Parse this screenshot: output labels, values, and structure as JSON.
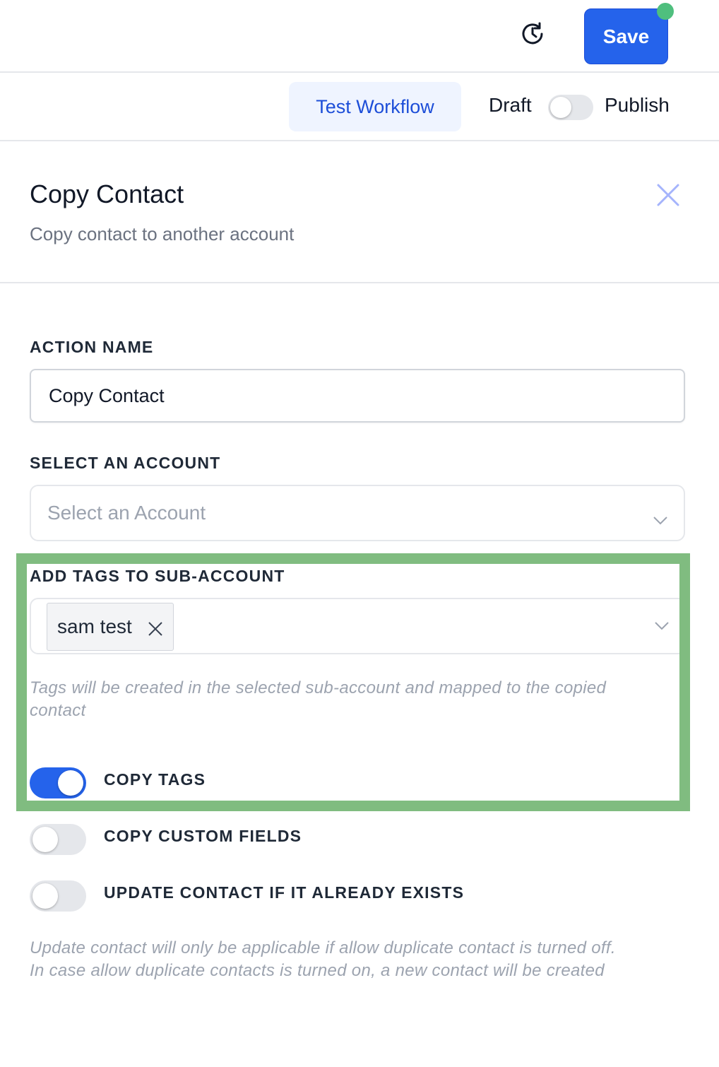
{
  "topbar": {
    "history_icon": "history-clock-icon",
    "save_label": "Save",
    "status_dot_color": "#4fbf7e"
  },
  "actionbar": {
    "test_workflow_label": "Test Workflow",
    "draft_label": "Draft",
    "publish_label": "Publish",
    "publish_toggle_on": false
  },
  "panel": {
    "title": "Copy Contact",
    "subtitle": "Copy contact to another account",
    "close_icon": "close-icon"
  },
  "form": {
    "action_name_label": "ACTION NAME",
    "action_name_value": "Copy Contact",
    "account_label": "SELECT AN ACCOUNT",
    "account_placeholder": "Select an Account",
    "tags_label": "ADD TAGS TO SUB-ACCOUNT",
    "tags": [
      "sam test"
    ],
    "tags_hint_line1": "Tags will be created in the selected sub-account and mapped to the copied",
    "tags_hint_line2": "contact",
    "toggles": [
      {
        "label": "COPY TAGS",
        "on": true
      },
      {
        "label": "COPY CUSTOM FIELDS",
        "on": false
      },
      {
        "label": "UPDATE CONTACT IF IT ALREADY EXISTS",
        "on": false
      }
    ],
    "update_hint_line1": "Update contact will only be applicable if allow duplicate contact is turned off.",
    "update_hint_line2": "In case allow duplicate contacts is turned on, a new contact will be created"
  },
  "colors": {
    "primary": "#2563eb",
    "highlight": "#80bc80"
  }
}
